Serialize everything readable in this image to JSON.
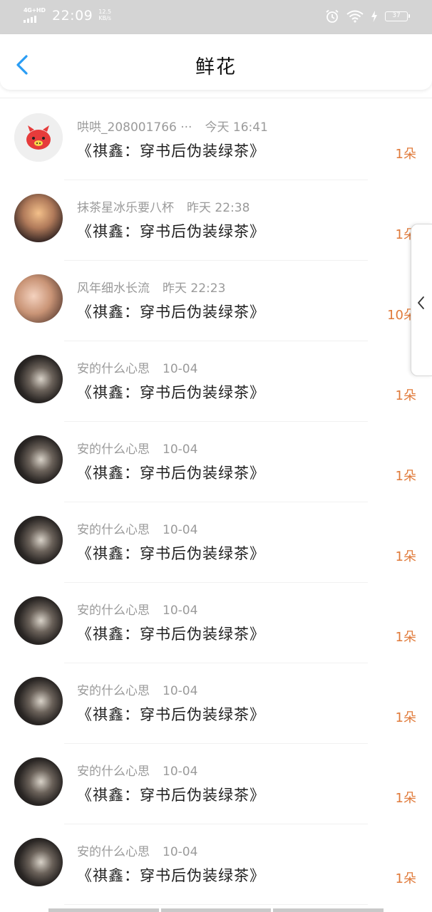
{
  "status_bar": {
    "network": "4G+HD",
    "time": "22:09",
    "speed_value": "12.5",
    "speed_unit": "KB/s",
    "battery": "37"
  },
  "header": {
    "title": "鲜花"
  },
  "items": [
    {
      "username": "哄哄_208001766 ···",
      "time": "今天 16:41",
      "book": "《祺鑫：穿书后伪装绿茶》",
      "count": "1朵",
      "avatar": "pig"
    },
    {
      "username": "抹茶星冰乐要八杯",
      "time": "昨天 22:38",
      "book": "《祺鑫：穿书后伪装绿茶》",
      "count": "1朵",
      "avatar": "sunset"
    },
    {
      "username": "风年细水长流",
      "time": "昨天 22:23",
      "book": "《祺鑫：穿书后伪装绿茶》",
      "count": "10朵",
      "avatar": "girls"
    },
    {
      "username": "安的什么心思",
      "time": "10-04",
      "book": "《祺鑫：穿书后伪装绿茶》",
      "count": "1朵",
      "avatar": "dark"
    },
    {
      "username": "安的什么心思",
      "time": "10-04",
      "book": "《祺鑫：穿书后伪装绿茶》",
      "count": "1朵",
      "avatar": "dark"
    },
    {
      "username": "安的什么心思",
      "time": "10-04",
      "book": "《祺鑫：穿书后伪装绿茶》",
      "count": "1朵",
      "avatar": "dark"
    },
    {
      "username": "安的什么心思",
      "time": "10-04",
      "book": "《祺鑫：穿书后伪装绿茶》",
      "count": "1朵",
      "avatar": "dark"
    },
    {
      "username": "安的什么心思",
      "time": "10-04",
      "book": "《祺鑫：穿书后伪装绿茶》",
      "count": "1朵",
      "avatar": "dark"
    },
    {
      "username": "安的什么心思",
      "time": "10-04",
      "book": "《祺鑫：穿书后伪装绿茶》",
      "count": "1朵",
      "avatar": "dark"
    },
    {
      "username": "安的什么心思",
      "time": "10-04",
      "book": "《祺鑫：穿书后伪装绿茶》",
      "count": "1朵",
      "avatar": "dark"
    }
  ],
  "colors": {
    "accent_back": "#2a9df4",
    "flower_count": "#e07a3a",
    "status_bar_bg": "#d4d4d4"
  }
}
